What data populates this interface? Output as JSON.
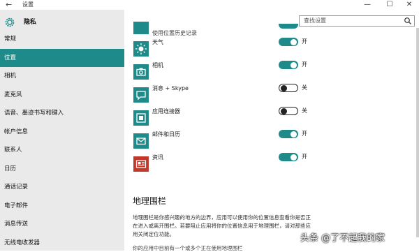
{
  "window": {
    "back_glyph": "←",
    "title": "设置",
    "minimize_glyph": "—",
    "maximize_glyph": "☐",
    "close_glyph": "✕"
  },
  "sidebar": {
    "title": "隐私",
    "items": [
      {
        "label": "常规",
        "active": false
      },
      {
        "label": "位置",
        "active": true
      },
      {
        "label": "相机",
        "active": false
      },
      {
        "label": "麦克风",
        "active": false
      },
      {
        "label": "语音、墨迹书写和键入",
        "active": false
      },
      {
        "label": "帐户信息",
        "active": false
      },
      {
        "label": "联系人",
        "active": false
      },
      {
        "label": "日历",
        "active": false
      },
      {
        "label": "通话记录",
        "active": false
      },
      {
        "label": "电子邮件",
        "active": false
      },
      {
        "label": "消息传送",
        "active": false
      },
      {
        "label": "无线电收发器",
        "active": false
      }
    ]
  },
  "search": {
    "placeholder": "查找设置"
  },
  "apps": {
    "history_label": "使用位置历史记录",
    "items": [
      {
        "name": "天气",
        "state": "开",
        "on": true,
        "icon": "weather-icon"
      },
      {
        "name": "相机",
        "state": "开",
        "on": true,
        "icon": "camera-icon"
      },
      {
        "name": "消息 + Skype",
        "state": "关",
        "on": false,
        "icon": "messaging-icon"
      },
      {
        "name": "应用连接器",
        "state": "关",
        "on": false,
        "icon": "app-connector-icon"
      },
      {
        "name": "邮件和日历",
        "state": "开",
        "on": true,
        "icon": "mail-calendar-icon"
      },
      {
        "name": "资讯",
        "state": "开",
        "on": true,
        "icon": "news-icon"
      }
    ]
  },
  "geofence": {
    "title": "地理围栏",
    "description": "地理围栏是你感兴趣的地方的边界，应用可以使用你的位置信息查看你是否正在进入或离开围栏。若要阻止应用将你的位置信息用于地理围栏，请对那些应用关闭定位功能。",
    "partial_line": "你的应用中目前有一个或多个正在使用地理围栏"
  },
  "watermark": "头条 @了不起我的家",
  "colors": {
    "accent": "#1e8a8a",
    "sidebar_bg": "#eaeaea"
  }
}
